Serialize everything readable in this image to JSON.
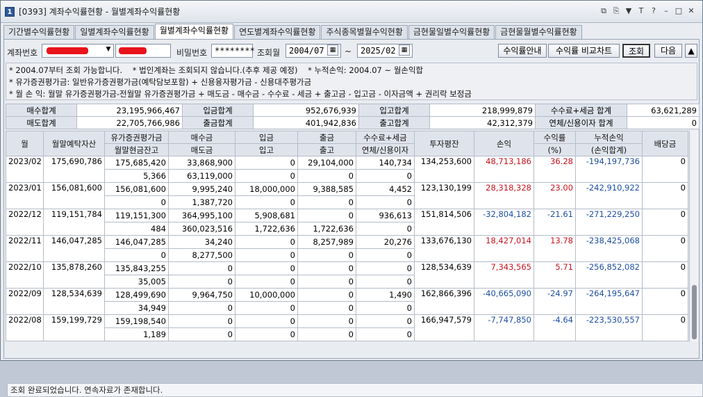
{
  "window": {
    "number": "1",
    "title": "[0393] 계좌수익률현황 - 월별계좌수익률현황",
    "icons": [
      "restore-icon",
      "copy-icon",
      "pin-icon",
      "font-icon",
      "help-icon",
      "minimize-icon",
      "maximize-icon",
      "close-icon"
    ]
  },
  "tabs": [
    {
      "label": "기간별수익률현황",
      "active": false
    },
    {
      "label": "일별계좌수익률현황",
      "active": false
    },
    {
      "label": "월별계좌수익률현황",
      "active": true
    },
    {
      "label": "연도별계좌수익률현황",
      "active": false
    },
    {
      "label": "주식종목별월수익현황",
      "active": false
    },
    {
      "label": "금현물일별수익률현황",
      "active": false
    },
    {
      "label": "금현물월별수익률현황",
      "active": false
    }
  ],
  "form": {
    "account_label": "계좌번호",
    "password_label": "비밀번호",
    "password_value": "********",
    "period_label": "조회월",
    "from": "2004/07",
    "tilde": "~",
    "to": "2025/02",
    "buttons": {
      "guide": "수익률안내",
      "compare": "수익률 비교차트",
      "query": "조회",
      "next": "다음",
      "up": "▲"
    }
  },
  "notes": [
    "* 2004.07부터 조회 가능합니다.    * 법인계좌는 조회되지 않습니다.(추후 제공 예정)    * 누적손익: 2004.07 ~ 월손익합",
    "* 유가증권평가금: 일반유가증권평가금(예탁담보포함) + 신용융자평가금 - 신용대주평가금",
    "* 월 손 익: 월말 유가증권평가금-전월말 유가증권평가금 + 매도금 - 매수금 - 수수료 - 세금 + 출고금 - 입고금 - 이자금액 + 권리락 보정금"
  ],
  "summary": {
    "row1": [
      {
        "label": "매수합계",
        "value": "23,195,966,467"
      },
      {
        "label": "입금합계",
        "value": "952,676,939"
      },
      {
        "label": "입고합계",
        "value": "218,999,879"
      },
      {
        "label": "수수료+세금 합계",
        "value": "63,621,289"
      }
    ],
    "row2": [
      {
        "label": "매도합계",
        "value": "22,705,766,986"
      },
      {
        "label": "출금합계",
        "value": "401,942,836"
      },
      {
        "label": "출고합계",
        "value": "42,312,379"
      },
      {
        "label": "연체/신용이자 합계",
        "value": "0"
      }
    ]
  },
  "columns": {
    "month": "월",
    "deposit": "월말예탁자산",
    "sec_top": "유가증권평가금",
    "sec_bottom": "월말현금잔고",
    "buy_top": "매수금",
    "buy_bottom": "매도금",
    "in_top": "입금",
    "in_bottom": "입고",
    "out_top": "출금",
    "out_bottom": "출고",
    "fee_top": "수수료+세금",
    "fee_bottom": "연체/신용이자",
    "avg": "투자평잔",
    "pnl": "손익",
    "rate_top": "수익률",
    "rate_bottom": "(%)",
    "cum_top": "누적손익",
    "cum_bottom": "(손익합계)",
    "div": "배당금"
  },
  "rows": [
    {
      "month": "2023/02",
      "deposit": "175,690,786",
      "sec": "175,685,420",
      "cash": "5,366",
      "buy": "33,868,900",
      "sell": "63,119,000",
      "in": "0",
      "inq": "0",
      "out": "29,104,000",
      "outq": "0",
      "fee": "140,734",
      "interest": "0",
      "avg": "134,253,600",
      "pnl": "48,713,186",
      "rate": "36.28",
      "cum": "-194,197,736",
      "div": "0",
      "sign": "pos"
    },
    {
      "month": "2023/01",
      "deposit": "156,081,600",
      "sec": "156,081,600",
      "cash": "0",
      "buy": "9,995,240",
      "sell": "1,387,720",
      "in": "18,000,000",
      "inq": "0",
      "out": "9,388,585",
      "outq": "0",
      "fee": "4,452",
      "interest": "0",
      "avg": "123,130,199",
      "pnl": "28,318,328",
      "rate": "23.00",
      "cum": "-242,910,922",
      "div": "0",
      "sign": "pos"
    },
    {
      "month": "2022/12",
      "deposit": "119,151,784",
      "sec": "119,151,300",
      "cash": "484",
      "buy": "364,995,100",
      "sell": "360,023,516",
      "in": "5,908,681",
      "inq": "1,722,636",
      "out": "0",
      "outq": "1,722,636",
      "fee": "936,613",
      "interest": "0",
      "avg": "151,814,506",
      "pnl": "-32,804,182",
      "rate": "-21.61",
      "cum": "-271,229,250",
      "div": "0",
      "sign": "neg"
    },
    {
      "month": "2022/11",
      "deposit": "146,047,285",
      "sec": "146,047,285",
      "cash": "0",
      "buy": "34,240",
      "sell": "8,277,500",
      "in": "0",
      "inq": "0",
      "out": "8,257,989",
      "outq": "0",
      "fee": "20,276",
      "interest": "0",
      "avg": "133,676,130",
      "pnl": "18,427,014",
      "rate": "13.78",
      "cum": "-238,425,068",
      "div": "0",
      "sign": "pos"
    },
    {
      "month": "2022/10",
      "deposit": "135,878,260",
      "sec": "135,843,255",
      "cash": "35,005",
      "buy": "0",
      "sell": "0",
      "in": "0",
      "inq": "0",
      "out": "0",
      "outq": "0",
      "fee": "0",
      "interest": "0",
      "avg": "128,534,639",
      "pnl": "7,343,565",
      "rate": "5.71",
      "cum": "-256,852,082",
      "div": "0",
      "sign": "pos"
    },
    {
      "month": "2022/09",
      "deposit": "128,534,639",
      "sec": "128,499,690",
      "cash": "34,949",
      "buy": "9,964,750",
      "sell": "0",
      "in": "10,000,000",
      "inq": "0",
      "out": "0",
      "outq": "0",
      "fee": "1,490",
      "interest": "0",
      "avg": "162,866,396",
      "pnl": "-40,665,090",
      "rate": "-24.97",
      "cum": "-264,195,647",
      "div": "0",
      "sign": "neg"
    },
    {
      "month": "2022/08",
      "deposit": "159,199,729",
      "sec": "159,198,540",
      "cash": "1,189",
      "buy": "0",
      "sell": "0",
      "in": "0",
      "inq": "0",
      "out": "0",
      "outq": "0",
      "fee": "0",
      "interest": "0",
      "avg": "166,947,579",
      "pnl": "-7,747,850",
      "rate": "-4.64",
      "cum": "-223,530,557",
      "div": "0",
      "sign": "neg"
    }
  ],
  "colors": {
    "positive": "#c8141e",
    "negative": "#1d4fa1",
    "redaction": "#e8131b"
  },
  "status": "조회 완료되었습니다. 연속자료가 존재합니다."
}
